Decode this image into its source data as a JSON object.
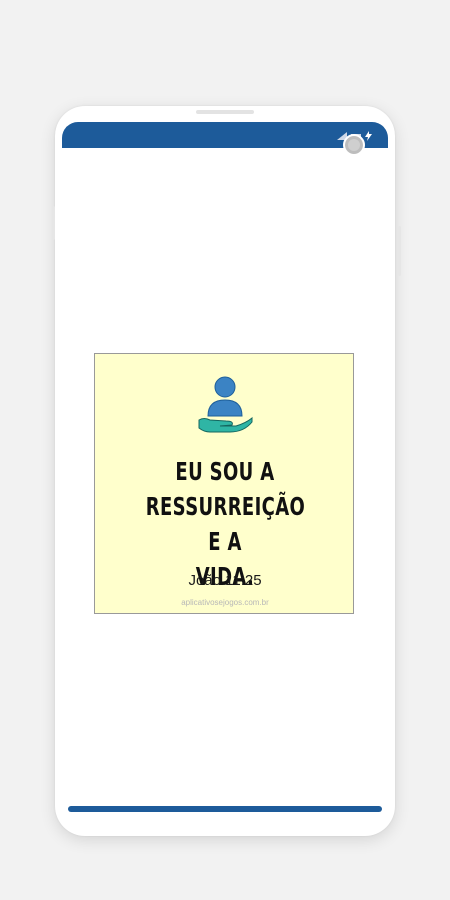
{
  "colors": {
    "status_bar": "#1d5b9a",
    "card_background": "#ffffcc",
    "icon_person": "#3b83c4",
    "icon_hand": "#2fb5a5"
  },
  "icons": {
    "status": [
      "signal-icon",
      "wifi-icon",
      "battery-charging-icon"
    ],
    "card": "person-in-hand-icon"
  },
  "card": {
    "quote_lines": [
      "EU SOU A",
      "RESSURREIÇÃO E A",
      "VIDA."
    ],
    "reference": "João 11:25",
    "watermark": "aplicativosejogos.com.br"
  }
}
